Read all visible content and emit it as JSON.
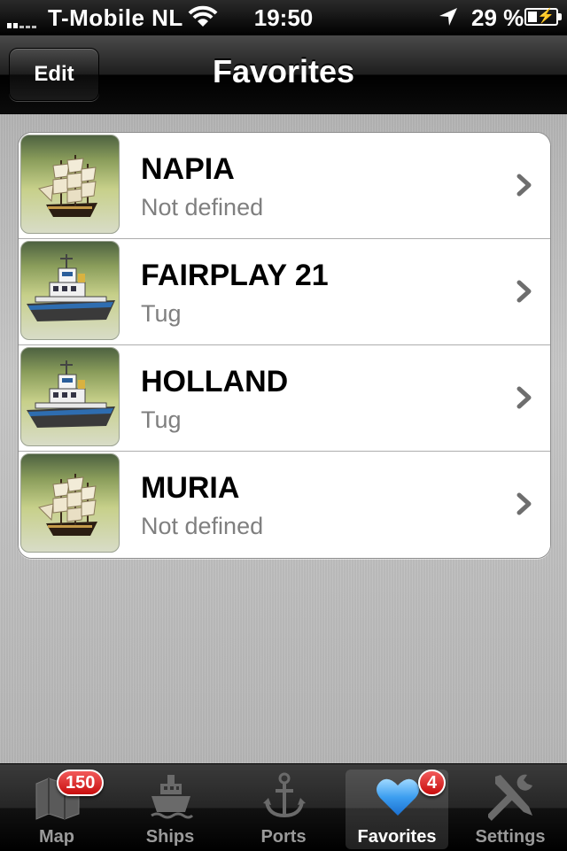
{
  "status_bar": {
    "carrier": "T-Mobile NL",
    "time": "19:50",
    "battery": "29 %"
  },
  "nav": {
    "edit_label": "Edit",
    "title": "Favorites"
  },
  "favorites": [
    {
      "name": "NAPIA",
      "type": "Not defined",
      "icon": "sailing-ship-icon"
    },
    {
      "name": "FAIRPLAY 21",
      "type": "Tug",
      "icon": "tugboat-icon"
    },
    {
      "name": "HOLLAND",
      "type": "Tug",
      "icon": "tugboat-icon"
    },
    {
      "name": "MURIA",
      "type": "Not defined",
      "icon": "sailing-ship-icon"
    }
  ],
  "tabs": [
    {
      "label": "Map",
      "icon": "map-icon",
      "badge": "150"
    },
    {
      "label": "Ships",
      "icon": "ship-icon"
    },
    {
      "label": "Ports",
      "icon": "anchor-icon"
    },
    {
      "label": "Favorites",
      "icon": "heart-icon",
      "badge": "4",
      "active": true
    },
    {
      "label": "Settings",
      "icon": "tools-icon"
    }
  ]
}
